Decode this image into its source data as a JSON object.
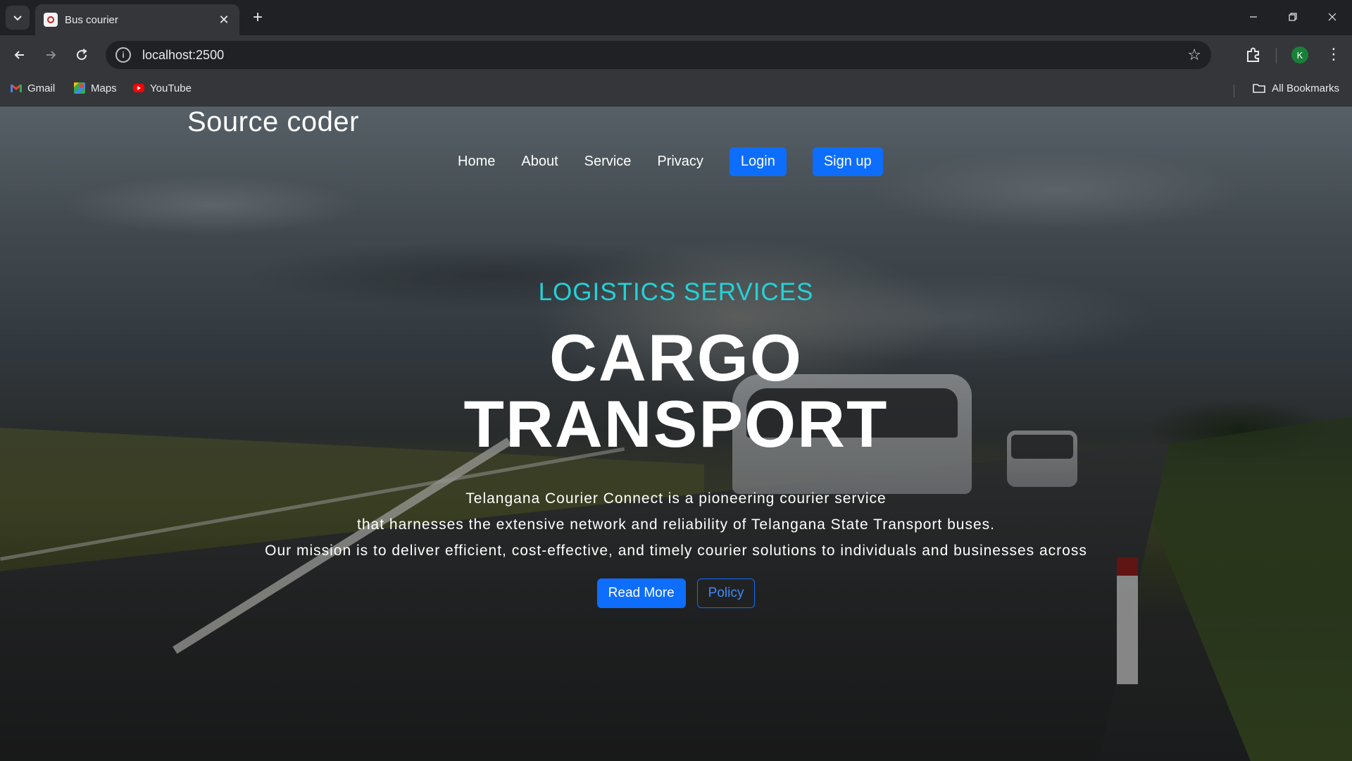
{
  "browser": {
    "tab_title": "Bus courier",
    "url": "localhost:2500",
    "profile_initial": "K",
    "bookmarks": [
      {
        "label": "Gmail",
        "icon": "gmail-icon"
      },
      {
        "label": "Maps",
        "icon": "maps-icon"
      },
      {
        "label": "YouTube",
        "icon": "youtube-icon"
      }
    ],
    "all_bookmarks_label": "All Bookmarks"
  },
  "site": {
    "brand": "Source coder",
    "nav": {
      "home": "Home",
      "about": "About",
      "service": "Service",
      "privacy": "Privacy",
      "login": "Login",
      "signup": "Sign up"
    },
    "hero": {
      "kicker": "LOGISTICS SERVICES",
      "headline_line1": "CARGO",
      "headline_line2": "TRANSPORT",
      "desc_line1": "Telangana Courier Connect is a pioneering courier service",
      "desc_line2": "that harnesses the extensive network and reliability of Telangana State Transport buses.",
      "desc_line3": "Our mission is to deliver efficient, cost-effective, and timely courier solutions to individuals and businesses across",
      "read_more": "Read More",
      "policy": "Policy"
    },
    "colors": {
      "primary": "#0d6efd",
      "kicker": "#22d3d8"
    }
  }
}
